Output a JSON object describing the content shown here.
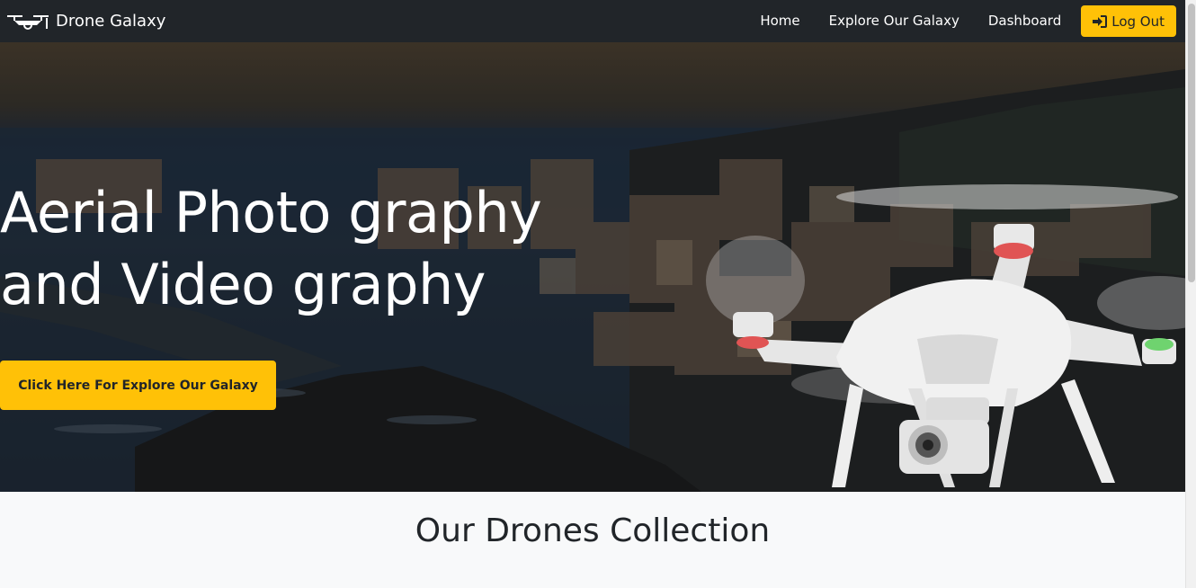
{
  "navbar": {
    "brand": "Drone Galaxy",
    "brand_icon": "drone-icon",
    "links": [
      "Home",
      "Explore Our Galaxy",
      "Dashboard"
    ],
    "logout_label": "Log Out",
    "logout_icon": "sign-in-icon",
    "bg_color": "#212529",
    "accent_color": "#ffc107"
  },
  "hero": {
    "title_line1": "Aerial Photo graphy",
    "title_line2": "and Video graphy",
    "cta_label": "Click Here For Explore Our Galaxy"
  },
  "section": {
    "title": "Our Drones Collection"
  }
}
